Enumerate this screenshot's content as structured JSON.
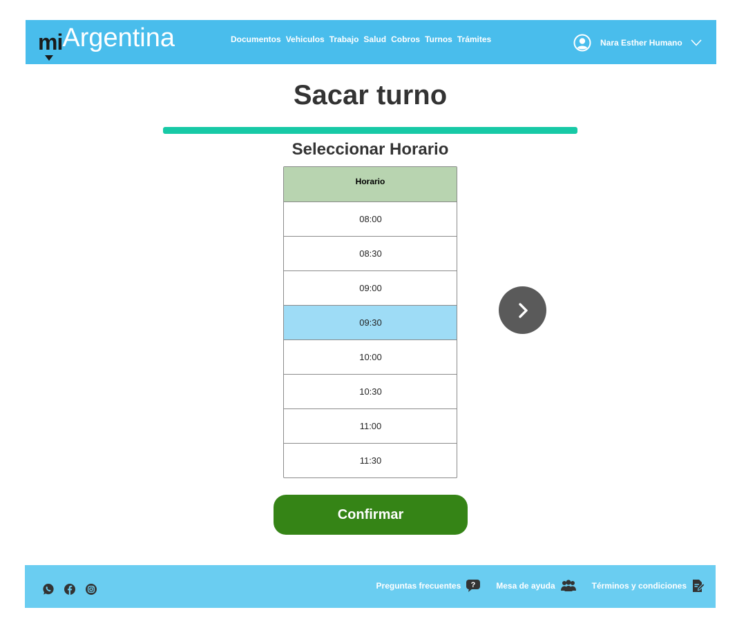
{
  "header": {
    "logo_mi": "mi",
    "logo_argentina": "Argentina",
    "nav": [
      "Documentos",
      "Vehiculos",
      "Trabajo",
      "Salud",
      "Cobros",
      "Turnos",
      "Trámites"
    ],
    "user_name": "Nara Esther Humano"
  },
  "main": {
    "title": "Sacar turno",
    "progress_percent": 100,
    "section_title": "Seleccionar Horario",
    "table": {
      "header": "Horario",
      "slots": [
        "08:00",
        "08:30",
        "09:00",
        "09:30",
        "10:00",
        "10:30",
        "11:00",
        "11:30"
      ],
      "selected_slot": "09:30"
    },
    "confirm_label": "Confirmar"
  },
  "footer": {
    "social_icons": [
      "whatsapp-icon",
      "facebook-icon",
      "instagram-icon"
    ],
    "links": [
      {
        "label": "Preguntas frecuentes",
        "icon": "faq-bubble-icon"
      },
      {
        "label": "Mesa de ayuda",
        "icon": "help-desk-people-icon"
      },
      {
        "label": "Términos y condiciones",
        "icon": "terms-document-icon"
      }
    ]
  },
  "colors": {
    "header_bg": "#49bdec",
    "footer_bg": "#6acdf1",
    "table_header_bg": "#b8d4b0",
    "selected_row_bg": "#9edcf6",
    "progress": "#17c9a6",
    "confirm_bg": "#358416",
    "next_button_bg": "#5a5a5a"
  }
}
